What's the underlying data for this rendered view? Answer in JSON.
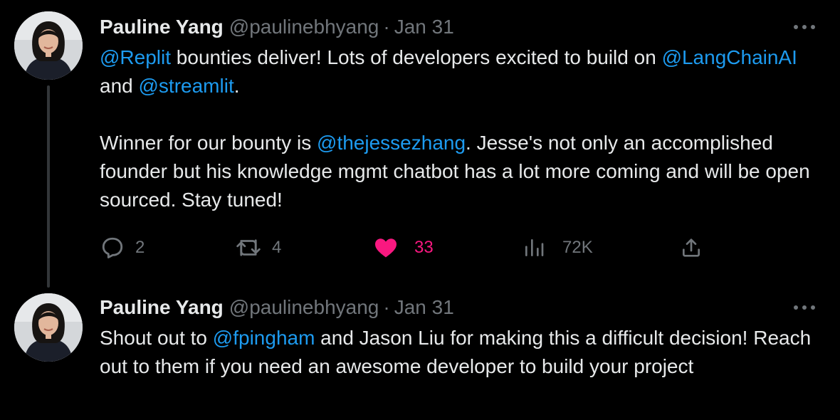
{
  "tweets": [
    {
      "author": {
        "display_name": "Pauline Yang",
        "handle": "@paulinebhyang"
      },
      "separator": "·",
      "date": "Jan 31",
      "body": {
        "p1_mention_1": "@Replit",
        "p1_text_1": " bounties deliver! Lots of developers excited to build on ",
        "p1_mention_2": "@LangChainAI",
        "p1_text_2": " and ",
        "p1_mention_3": "@streamlit",
        "p1_text_3": ".",
        "p2_text_1": "Winner for our bounty is ",
        "p2_mention_1": "@thejessezhang",
        "p2_text_2": ". Jesse's not only an accomplished founder but his knowledge mgmt chatbot has a lot more coming and will be open sourced. Stay tuned!"
      },
      "metrics": {
        "replies": "2",
        "retweets": "4",
        "likes": "33",
        "views": "72K"
      },
      "liked": true
    },
    {
      "author": {
        "display_name": "Pauline Yang",
        "handle": "@paulinebhyang"
      },
      "separator": "·",
      "date": "Jan 31",
      "body": {
        "text_1": "Shout out to ",
        "mention_1": "@fpingham",
        "text_2": " and Jason Liu for making this a difficult decision! Reach out to them if you need an awesome developer to build your project"
      }
    }
  ],
  "icons": {
    "more": "more-horizontal-icon",
    "reply": "reply-icon",
    "retweet": "retweet-icon",
    "like": "heart-icon",
    "views": "views-icon",
    "share": "share-icon"
  },
  "colors": {
    "background": "#000000",
    "text": "#e7e9ea",
    "muted": "#71767b",
    "link": "#1d9bf0",
    "like": "#f91880",
    "thread_line": "#333639"
  }
}
